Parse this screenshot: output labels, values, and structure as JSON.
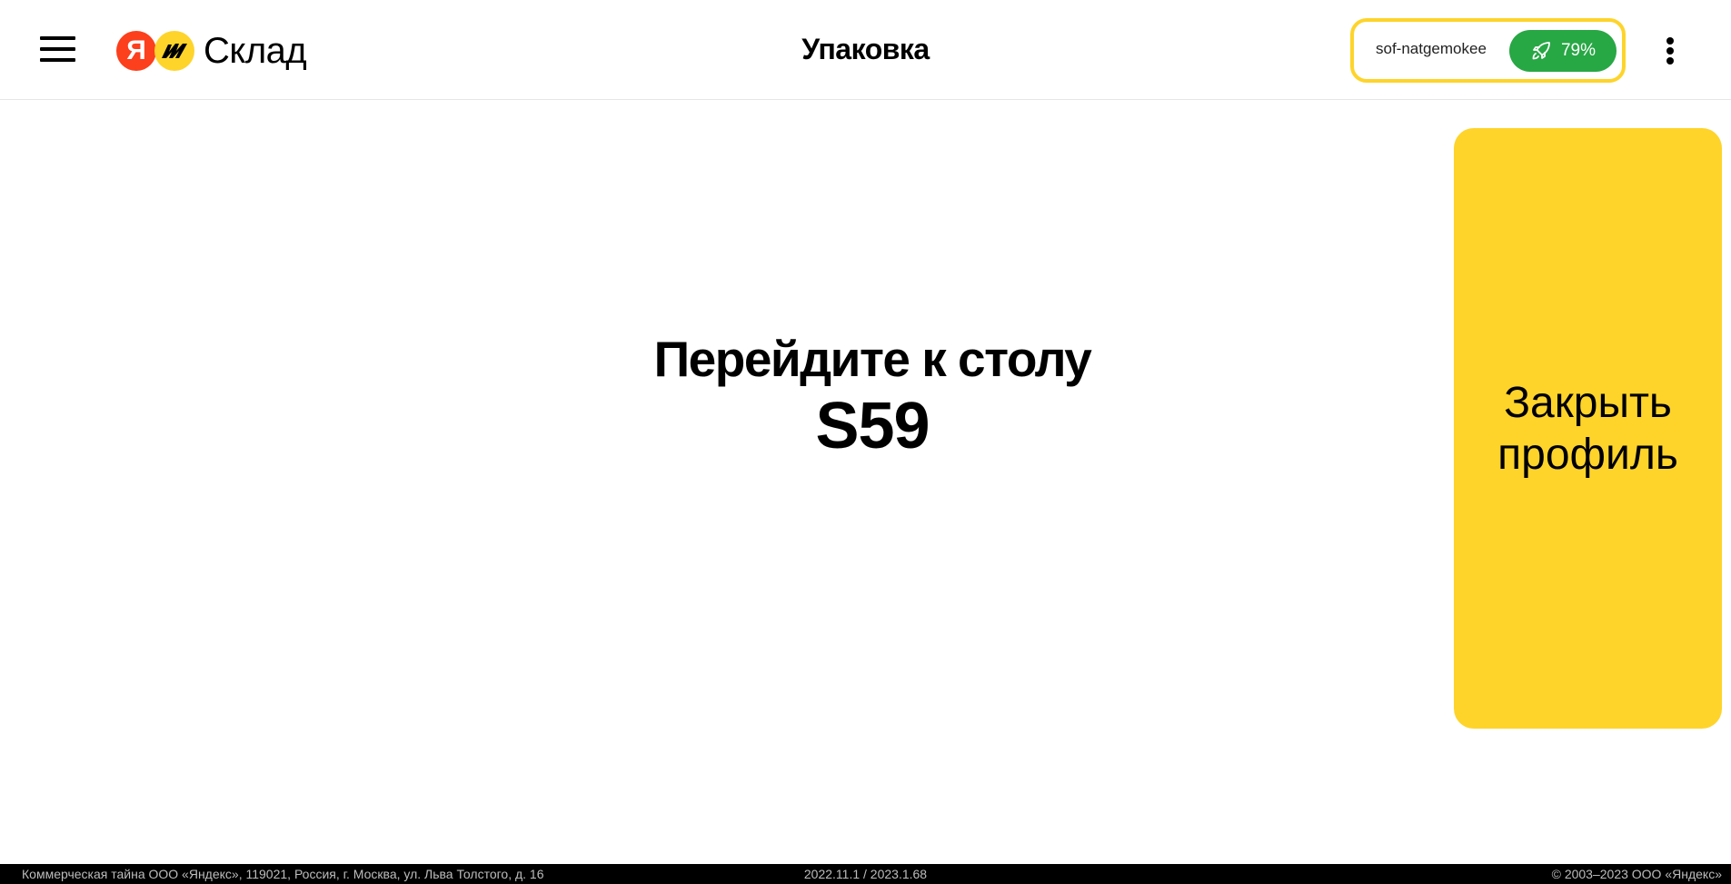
{
  "header": {
    "menu_icon": "hamburger-menu-icon",
    "logo": {
      "ya_letter": "Я",
      "brand_text": "Склад"
    },
    "title": "Упаковка",
    "user": {
      "login": "sof-natgemokee",
      "progress_icon": "rocket-icon",
      "progress_label": "79%",
      "progress_value": 79,
      "progress_color": "#28a745",
      "border_color": "#fed42b"
    },
    "more_icon": "vertical-dots-icon"
  },
  "main": {
    "instruction": "Перейдите к столу",
    "table_code": "S59",
    "close_profile_label": "Закрыть профиль",
    "close_profile_color": "#fed42b"
  },
  "footer": {
    "legal": "Коммерческая тайна ООО «Яндекс», 119021, Россия, г. Москва, ул. Льва Толстого, д. 16",
    "version": "2022.11.1 / 2023.1.68",
    "copyright": "© 2003–2023 ООО «Яндекс»"
  }
}
